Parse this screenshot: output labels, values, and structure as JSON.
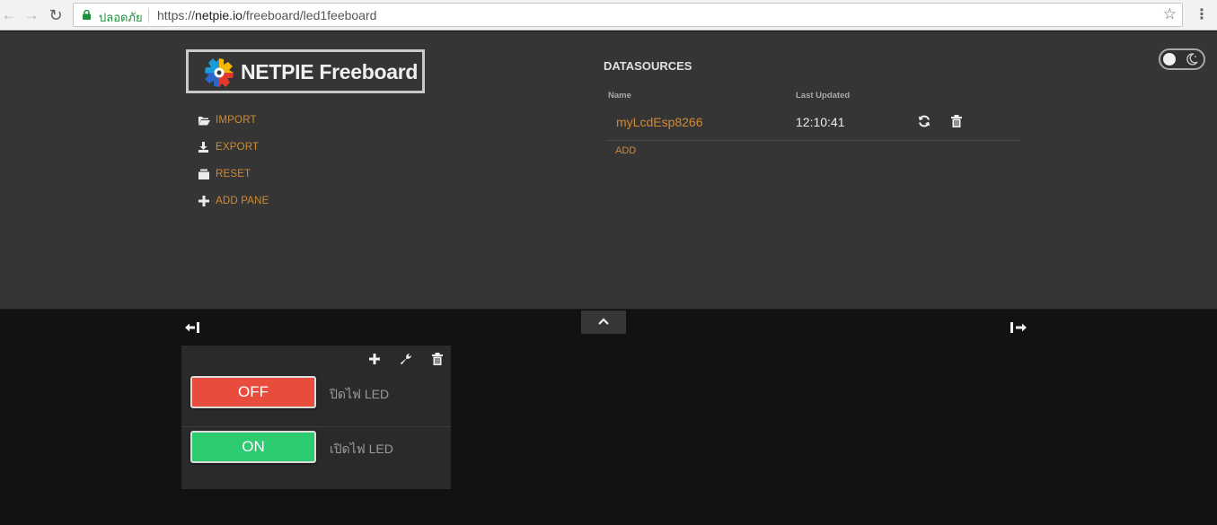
{
  "browser": {
    "secure_label": "ปลอดภัย",
    "url_scheme": "https://",
    "url_host": "netpie.io",
    "url_path": "/freeboard/led1feeboard"
  },
  "header": {
    "logo_text": "NETPIE Freeboard",
    "menu": [
      {
        "label": "IMPORT",
        "icon": "folder-open-icon"
      },
      {
        "label": "EXPORT",
        "icon": "download-icon"
      },
      {
        "label": "RESET",
        "icon": "clear-icon"
      },
      {
        "label": "ADD PANE",
        "icon": "plus-icon"
      }
    ]
  },
  "datasources": {
    "title": "DATASOURCES",
    "col_name": "Name",
    "col_updated": "Last Updated",
    "rows": [
      {
        "name": "myLcdEsp8266",
        "last_updated": "12:10:41"
      }
    ],
    "add_label": "ADD"
  },
  "pane": {
    "widgets": [
      {
        "button_label": "OFF",
        "caption": "ปิดไฟ LED",
        "color": "#e74c3c"
      },
      {
        "button_label": "ON",
        "caption": "เปิดไฟ LED",
        "color": "#2ecc71"
      }
    ]
  },
  "colors": {
    "accent": "#d08b34",
    "header_bg": "#353535",
    "board_bg": "#121213",
    "pane_bg": "#2a2a2a"
  }
}
